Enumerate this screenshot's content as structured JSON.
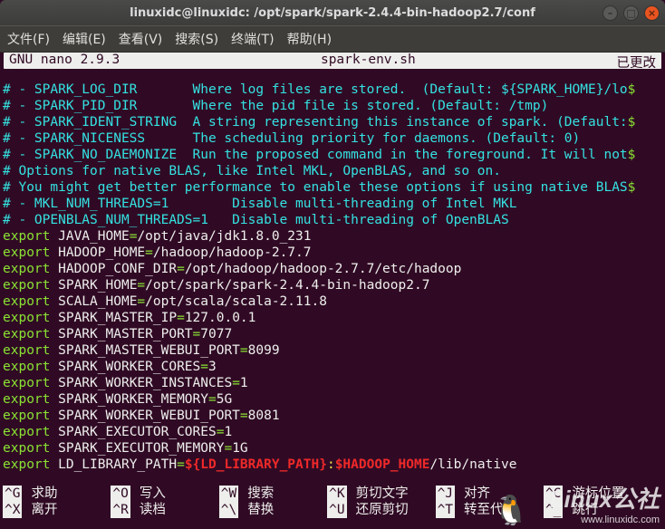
{
  "window": {
    "title": "linuxidc@linuxidc: /opt/spark/spark-2.4.4-bin-hadoop2.7/conf"
  },
  "menubar": [
    "文件(F)",
    "编辑(E)",
    "查看(V)",
    "搜索(S)",
    "终端(T)",
    "帮助(H)"
  ],
  "nano": {
    "version": "GNU nano 2.9.3",
    "filename": "spark-env.sh",
    "status": "已更改"
  },
  "lines": [
    [
      [
        "cyan",
        "# - SPARK_LOG_DIR       Where log files are stored.  (Default: ${SPARK_HOME}/lo"
      ],
      [
        "green",
        "$"
      ]
    ],
    [
      [
        "cyan",
        "# - SPARK_PID_DIR       Where the pid file is stored. (Default: /tmp)"
      ]
    ],
    [
      [
        "cyan",
        "# - SPARK_IDENT_STRING  A string representing this instance of spark. (Default:"
      ],
      [
        "green",
        "$"
      ]
    ],
    [
      [
        "cyan",
        "# - SPARK_NICENESS      The scheduling priority for daemons. (Default: 0)"
      ]
    ],
    [
      [
        "cyan",
        "# - SPARK_NO_DAEMONIZE  Run the proposed command in the foreground. It will not"
      ],
      [
        "green",
        "$"
      ]
    ],
    [
      [
        "cyan",
        "# Options for native BLAS, like Intel MKL, OpenBLAS, and so on."
      ]
    ],
    [
      [
        "cyan",
        "# You might get better performance to enable these options if using native BLAS"
      ],
      [
        "green",
        "$"
      ]
    ],
    [
      [
        "cyan",
        "# - MKL_NUM_THREADS=1        Disable multi-threading of Intel MKL"
      ]
    ],
    [
      [
        "cyan",
        "# - OPENBLAS_NUM_THREADS=1   Disable multi-threading of OpenBLAS"
      ]
    ],
    [
      [
        "green",
        "export"
      ],
      [
        "white",
        " JAVA_HOME"
      ],
      [
        "green",
        "="
      ],
      [
        "white",
        "/opt/java/jdk1.8.0_231"
      ]
    ],
    [
      [
        "green",
        "export"
      ],
      [
        "white",
        " HADOOP_HOME"
      ],
      [
        "green",
        "="
      ],
      [
        "white",
        "/hadoop/hadoop-2.7.7"
      ]
    ],
    [
      [
        "green",
        "export"
      ],
      [
        "white",
        " HADOOP_CONF_DIR"
      ],
      [
        "green",
        "="
      ],
      [
        "white",
        "/opt/hadoop/hadoop-2.7.7/etc/hadoop"
      ]
    ],
    [
      [
        "green",
        "export"
      ],
      [
        "white",
        " SPARK_HOME"
      ],
      [
        "green",
        "="
      ],
      [
        "white",
        "/opt/spark/spark-2.4.4-bin-hadoop2.7"
      ]
    ],
    [
      [
        "green",
        "export"
      ],
      [
        "white",
        " SCALA_HOME"
      ],
      [
        "green",
        "="
      ],
      [
        "white",
        "/opt/scala/scala-2.11.8"
      ]
    ],
    [
      [
        "green",
        "export"
      ],
      [
        "white",
        " SPARK_MASTER_IP"
      ],
      [
        "green",
        "="
      ],
      [
        "white",
        "127.0.0.1"
      ]
    ],
    [
      [
        "green",
        "export"
      ],
      [
        "white",
        " SPARK_MASTER_PORT"
      ],
      [
        "green",
        "="
      ],
      [
        "white",
        "7077"
      ]
    ],
    [
      [
        "green",
        "export"
      ],
      [
        "white",
        " SPARK_MASTER_WEBUI_PORT"
      ],
      [
        "green",
        "="
      ],
      [
        "white",
        "8099"
      ]
    ],
    [
      [
        "green",
        "export"
      ],
      [
        "white",
        " SPARK_WORKER_CORES"
      ],
      [
        "green",
        "="
      ],
      [
        "white",
        "3"
      ]
    ],
    [
      [
        "green",
        "export"
      ],
      [
        "white",
        " SPARK_WORKER_INSTANCES"
      ],
      [
        "green",
        "="
      ],
      [
        "white",
        "1"
      ]
    ],
    [
      [
        "green",
        "export"
      ],
      [
        "white",
        " SPARK_WORKER_MEMORY"
      ],
      [
        "green",
        "="
      ],
      [
        "white",
        "5G"
      ]
    ],
    [
      [
        "green",
        "export"
      ],
      [
        "white",
        " SPARK_WORKER_WEBUI_PORT"
      ],
      [
        "green",
        "="
      ],
      [
        "white",
        "8081"
      ]
    ],
    [
      [
        "green",
        "export"
      ],
      [
        "white",
        " SPARK_EXECUTOR_CORES"
      ],
      [
        "green",
        "="
      ],
      [
        "white",
        "1"
      ]
    ],
    [
      [
        "green",
        "export"
      ],
      [
        "white",
        " SPARK_EXECUTOR_MEMORY"
      ],
      [
        "green",
        "="
      ],
      [
        "white",
        "1G"
      ]
    ],
    [
      [
        "green",
        "export"
      ],
      [
        "white",
        " LD_LIBRARY_PATH"
      ],
      [
        "green",
        "="
      ],
      [
        "red",
        "${LD_LIBRARY_PATH}"
      ],
      [
        "yellow",
        ":"
      ],
      [
        "red",
        "$HADOOP_HOME"
      ],
      [
        "white",
        "/lib/native"
      ]
    ]
  ],
  "shortcuts": [
    {
      "key": "^G",
      "label": "求助"
    },
    {
      "key": "^O",
      "label": "写入"
    },
    {
      "key": "^W",
      "label": "搜索"
    },
    {
      "key": "^K",
      "label": "剪切文字"
    },
    {
      "key": "^J",
      "label": "对齐"
    },
    {
      "key": "^C",
      "label": "游标位置"
    },
    {
      "key": "^X",
      "label": "离开"
    },
    {
      "key": "^R",
      "label": "读档"
    },
    {
      "key": "^\\",
      "label": "替换"
    },
    {
      "key": "^U",
      "label": "还原剪切"
    },
    {
      "key": "^T",
      "label": "转至代码"
    },
    {
      "key": "^_",
      "label": "跳行"
    }
  ],
  "watermark": {
    "big": "Linux公社",
    "small": "www.linuxidc.com"
  }
}
